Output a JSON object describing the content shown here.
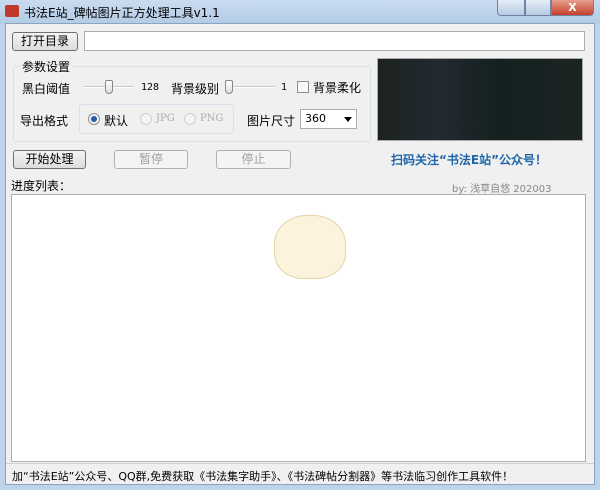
{
  "window": {
    "title": "书法E站_碑帖图片正方处理工具v1.1",
    "close_glyph": "X"
  },
  "toolbar": {
    "open_dir_label": "打开目录",
    "dir_path": ""
  },
  "params": {
    "group_label": "参数设置",
    "threshold_label": "黑白阈值",
    "threshold_value": "128",
    "threshold_fraction": 0.5,
    "bg_level_label": "背景级别",
    "bg_level_value": "1",
    "bg_level_fraction": 0.0,
    "bg_soften_label": "背景柔化",
    "bg_soften_checked": false,
    "export_format_label": "导出格式",
    "formats": [
      {
        "label": "默认",
        "selected": true
      },
      {
        "label": "JPG",
        "selected": false
      },
      {
        "label": "PNG",
        "selected": false
      }
    ],
    "image_size_label": "图片尺寸",
    "image_size_value": "360"
  },
  "actions": {
    "start_label": "开始处理",
    "pause_label": "暂停",
    "stop_label": "停止"
  },
  "promo": "扫码关注“书法E站”公众号！",
  "progress": {
    "label": "进度列表：",
    "credit": "by: 浅草自悠    202003",
    "items": []
  },
  "status_bar": "加“书法E站”公众号、QQ群,免费获取《书法集字助手》、《书法碑帖分割器》等书法临习创作工具软件！"
}
